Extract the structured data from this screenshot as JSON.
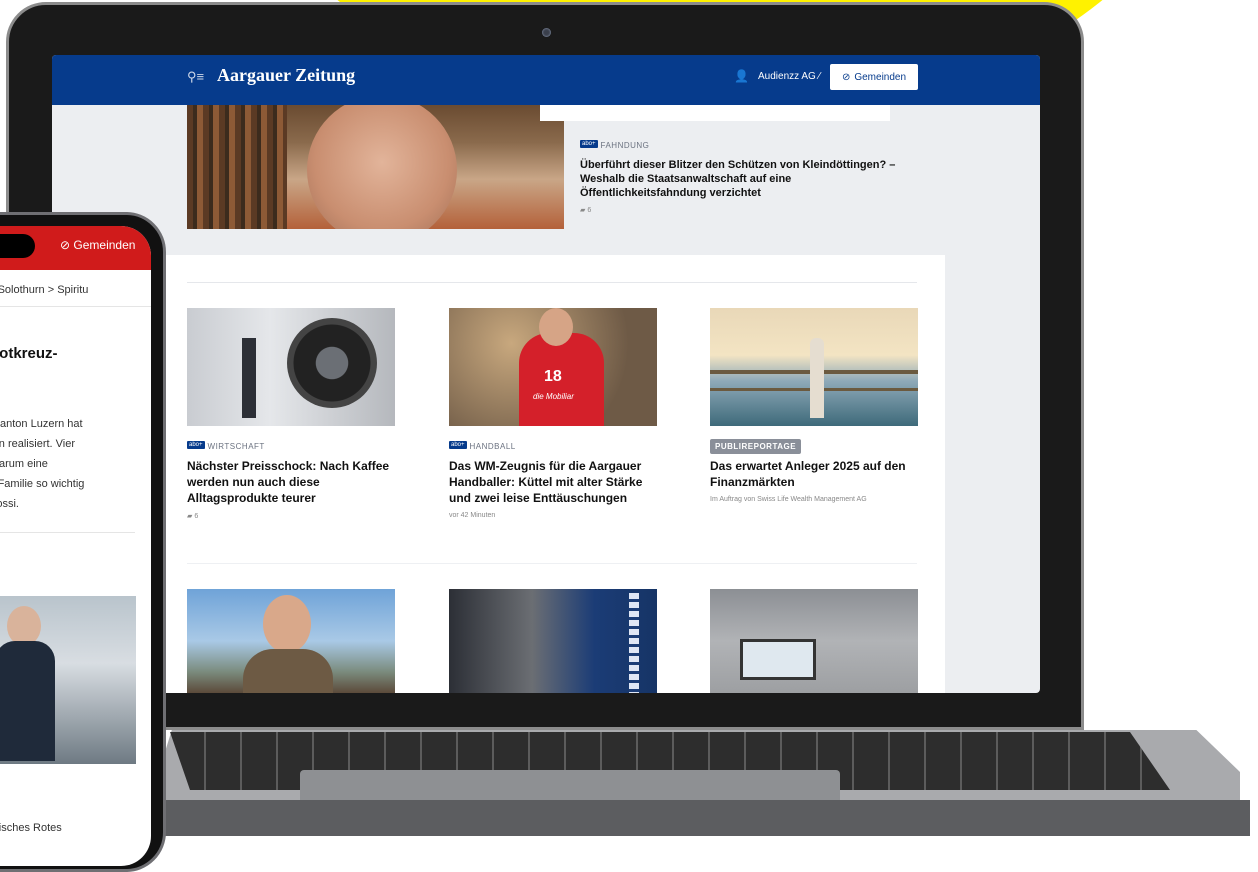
{
  "laptop": {
    "header": {
      "menu_icon": "search-menu-icon",
      "logo": "Aargauer Zeitung",
      "user_icon": "user-icon",
      "user_name": "Audienzz AG ⁄",
      "gemeinden_label": "Gemeinden",
      "gemeinden_icon": "compass-icon"
    },
    "featured": {
      "badge": "abo+",
      "kicker": "FAHNDUNG",
      "title": "Überführt dieser Blitzer den Schützen von Kleindöttingen? – Weshalb die Staatsanwaltschaft auf eine Öffentlichkeitsfahndung verzichtet",
      "comments": "6"
    },
    "cards": [
      {
        "badge": "abo+",
        "kicker": "WIRTSCHAFT",
        "title": "Nächster Preisschock: Nach Kaffee werden nun auch diese Alltagsprodukte teurer",
        "meta": "6"
      },
      {
        "badge": "abo+",
        "kicker": "HANDBALL",
        "title": "Das WM-Zeugnis für die Aargauer Handballer: Küttel mit alter Stärke und zwei leise Enttäuschungen",
        "meta": "vor 42 Minuten"
      },
      {
        "promo": "PUBLIREPORTAGE",
        "title": "Das erwartet Anleger 2025 auf den Finanzmärkten",
        "meta": "Im Auftrag von Swiss Life Wealth Management AG"
      }
    ],
    "jersey_text": "die Mobiliar",
    "jersey_number": "18"
  },
  "phone": {
    "gemeinden_label": "Gemeinden",
    "breadcrumb": "anton Solothurn  >  Spiritu",
    "title_lines": [
      "n Rotkreuz-"
    ],
    "lead_lines": [
      "SRK Kanton Luzern hat",
      "Fahrten realisiert. Vier",
      "ard. Warum eine",
      "d ihre Familie so wichtig",
      "tteo Rossi."
    ],
    "bottom_text": "weizerisches Rotes"
  },
  "colors": {
    "brand_blue": "#063b8c",
    "phone_red": "#d01b1b",
    "accent_yellow": "#fff200"
  }
}
